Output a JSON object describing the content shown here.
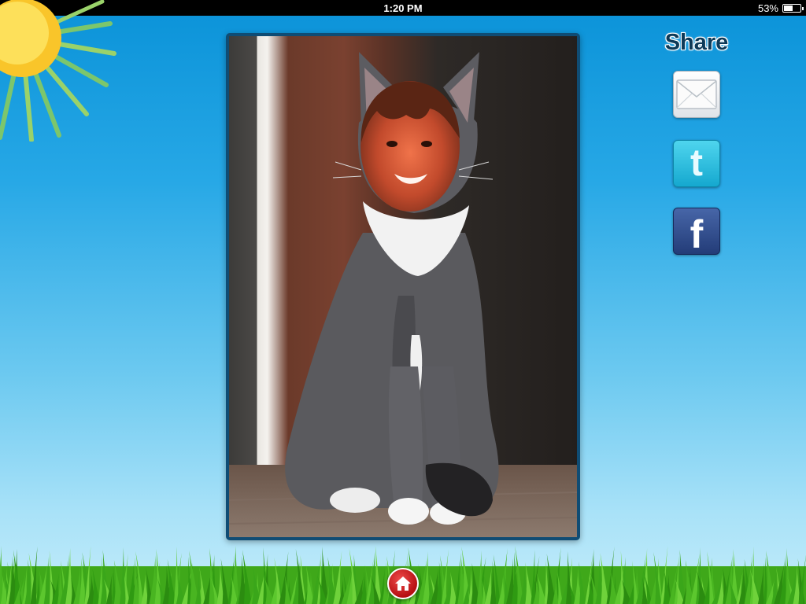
{
  "status_bar": {
    "device": "iPad",
    "time": "1:20 PM",
    "battery": "53%",
    "battery_level": 0.53,
    "wifi_icon": "wifi-icon"
  },
  "share": {
    "title": "Share",
    "buttons": [
      {
        "id": "email",
        "icon": "envelope-icon"
      },
      {
        "id": "twitter",
        "icon": "twitter-icon",
        "glyph": "t"
      },
      {
        "id": "facebook",
        "icon": "facebook-icon",
        "glyph": "f"
      }
    ]
  },
  "photo": {
    "subject": "cat-with-face-cutout"
  },
  "home": {
    "icon": "home-icon"
  },
  "colors": {
    "sky_top": "#0a92d8",
    "sky_bottom": "#c4ecfa",
    "frame": "#0f4c74",
    "home_red": "#c2141a",
    "share_title": "#0d3a58"
  }
}
